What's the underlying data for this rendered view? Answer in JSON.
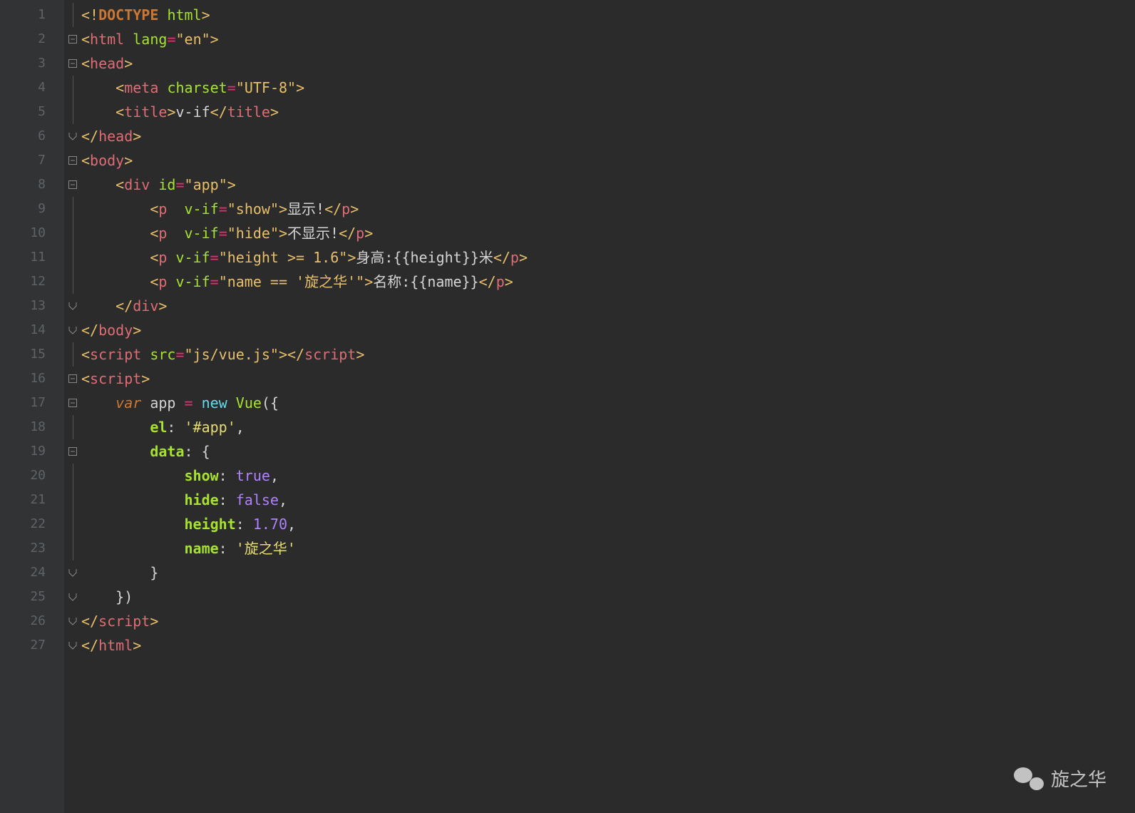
{
  "watermark": {
    "label": "旋之华"
  },
  "lines": [
    {
      "n": "1",
      "fold": "",
      "html": "<span class='tag-angle'>&lt;!</span><span class='tag-doctype'>DOCTYPE</span> <span class='tag-doctype-kw'>html</span><span class='tag-angle'>&gt;</span>"
    },
    {
      "n": "2",
      "fold": "open",
      "html": "<span class='tag-angle'>&lt;</span><span class='tag-name'>html</span> <span class='attr-name'>lang</span><span class='op'>=</span><span class='string'>\"en\"</span><span class='tag-angle'>&gt;</span>"
    },
    {
      "n": "3",
      "fold": "open",
      "html": "<span class='tag-angle'>&lt;</span><span class='tag-name'>head</span><span class='tag-angle'>&gt;</span>"
    },
    {
      "n": "4",
      "fold": "",
      "html": "    <span class='tag-angle'>&lt;</span><span class='tag-name'>meta</span> <span class='attr-name'>charset</span><span class='op'>=</span><span class='string'>\"UTF-8\"</span><span class='tag-angle'>&gt;</span>"
    },
    {
      "n": "5",
      "fold": "",
      "html": "    <span class='tag-angle'>&lt;</span><span class='tag-name'>title</span><span class='tag-angle'>&gt;</span><span class='text'>v-if</span><span class='tag-angle'>&lt;/</span><span class='tag-name'>title</span><span class='tag-angle'>&gt;</span>"
    },
    {
      "n": "6",
      "fold": "close",
      "html": "<span class='tag-angle'>&lt;/</span><span class='tag-name'>head</span><span class='tag-angle'>&gt;</span>"
    },
    {
      "n": "7",
      "fold": "open",
      "html": "<span class='tag-angle'>&lt;</span><span class='tag-name'>body</span><span class='tag-angle'>&gt;</span>"
    },
    {
      "n": "8",
      "fold": "open",
      "html": "    <span class='tag-angle'>&lt;</span><span class='tag-name'>div</span> <span class='attr-name'>id</span><span class='op'>=</span><span class='string'>\"app\"</span><span class='tag-angle'>&gt;</span>"
    },
    {
      "n": "9",
      "fold": "",
      "html": "        <span class='tag-angle'>&lt;</span><span class='tag-name'>p</span>  <span class='attr-name'>v-if</span><span class='op'>=</span><span class='string'>\"show\"</span><span class='tag-angle'>&gt;</span><span class='text'>显示!</span><span class='tag-angle'>&lt;/</span><span class='tag-name'>p</span><span class='tag-angle'>&gt;</span>"
    },
    {
      "n": "10",
      "fold": "",
      "html": "        <span class='tag-angle'>&lt;</span><span class='tag-name'>p</span>  <span class='attr-name'>v-if</span><span class='op'>=</span><span class='string'>\"hide\"</span><span class='tag-angle'>&gt;</span><span class='text'>不显示!</span><span class='tag-angle'>&lt;/</span><span class='tag-name'>p</span><span class='tag-angle'>&gt;</span>"
    },
    {
      "n": "11",
      "fold": "",
      "html": "        <span class='tag-angle'>&lt;</span><span class='tag-name'>p</span> <span class='attr-name'>v-if</span><span class='op'>=</span><span class='string'>\"height &gt;= 1.6\"</span><span class='tag-angle'>&gt;</span><span class='text'>身高:{{height}}米</span><span class='tag-angle'>&lt;/</span><span class='tag-name'>p</span><span class='tag-angle'>&gt;</span>"
    },
    {
      "n": "12",
      "fold": "",
      "html": "        <span class='tag-angle'>&lt;</span><span class='tag-name'>p</span> <span class='attr-name'>v-if</span><span class='op'>=</span><span class='string'>\"name == '旋之华'\"</span><span class='tag-angle'>&gt;</span><span class='text'>名称:{{name}}</span><span class='tag-angle'>&lt;/</span><span class='tag-name'>p</span><span class='tag-angle'>&gt;</span>"
    },
    {
      "n": "13",
      "fold": "close",
      "html": "    <span class='tag-angle'>&lt;/</span><span class='tag-name'>div</span><span class='tag-angle'>&gt;</span>"
    },
    {
      "n": "14",
      "fold": "close",
      "html": "<span class='tag-angle'>&lt;/</span><span class='tag-name'>body</span><span class='tag-angle'>&gt;</span>"
    },
    {
      "n": "15",
      "fold": "",
      "html": "<span class='tag-angle'>&lt;</span><span class='tag-name'>script</span> <span class='attr-name'>src</span><span class='op'>=</span><span class='string'>\"js/vue.js\"</span><span class='tag-angle'>&gt;&lt;/</span><span class='tag-name'>script</span><span class='tag-angle'>&gt;</span>"
    },
    {
      "n": "16",
      "fold": "open",
      "html": "<span class='tag-angle'>&lt;</span><span class='tag-name'>script</span><span class='tag-angle'>&gt;</span>"
    },
    {
      "n": "17",
      "fold": "open",
      "html": "    <span class='js-kw'>var</span> <span class='js-ident'>app</span> <span class='op'>=</span> <span class='js-new'>new</span> <span class='js-class'>Vue</span><span class='punct'>({</span>"
    },
    {
      "n": "18",
      "fold": "",
      "html": "        <span class='js-propname'>el</span><span class='punct'>:</span> <span class='js-str'>'#app'</span><span class='punct'>,</span>"
    },
    {
      "n": "19",
      "fold": "open",
      "html": "        <span class='js-propname'>data</span><span class='punct'>: {</span>"
    },
    {
      "n": "20",
      "fold": "",
      "html": "            <span class='js-propname'>show</span><span class='punct'>:</span> <span class='js-bool'>true</span><span class='punct'>,</span>"
    },
    {
      "n": "21",
      "fold": "",
      "html": "            <span class='js-propname'>hide</span><span class='punct'>:</span> <span class='js-bool'>false</span><span class='punct'>,</span>"
    },
    {
      "n": "22",
      "fold": "",
      "html": "            <span class='js-propname'>height</span><span class='punct'>:</span> <span class='js-num'>1.70</span><span class='punct'>,</span>"
    },
    {
      "n": "23",
      "fold": "",
      "html": "            <span class='js-propname'>name</span><span class='punct'>:</span> <span class='js-str'>'旋之华'</span>"
    },
    {
      "n": "24",
      "fold": "close",
      "html": "        <span class='punct'>}</span>"
    },
    {
      "n": "25",
      "fold": "close",
      "html": "    <span class='punct'>})</span>"
    },
    {
      "n": "26",
      "fold": "close",
      "html": "<span class='tag-angle'>&lt;/</span><span class='tag-name'>script</span><span class='tag-angle'>&gt;</span>"
    },
    {
      "n": "27",
      "fold": "close",
      "html": "<span class='tag-angle'>&lt;/</span><span class='tag-name'>html</span><span class='tag-angle'>&gt;</span>"
    }
  ]
}
